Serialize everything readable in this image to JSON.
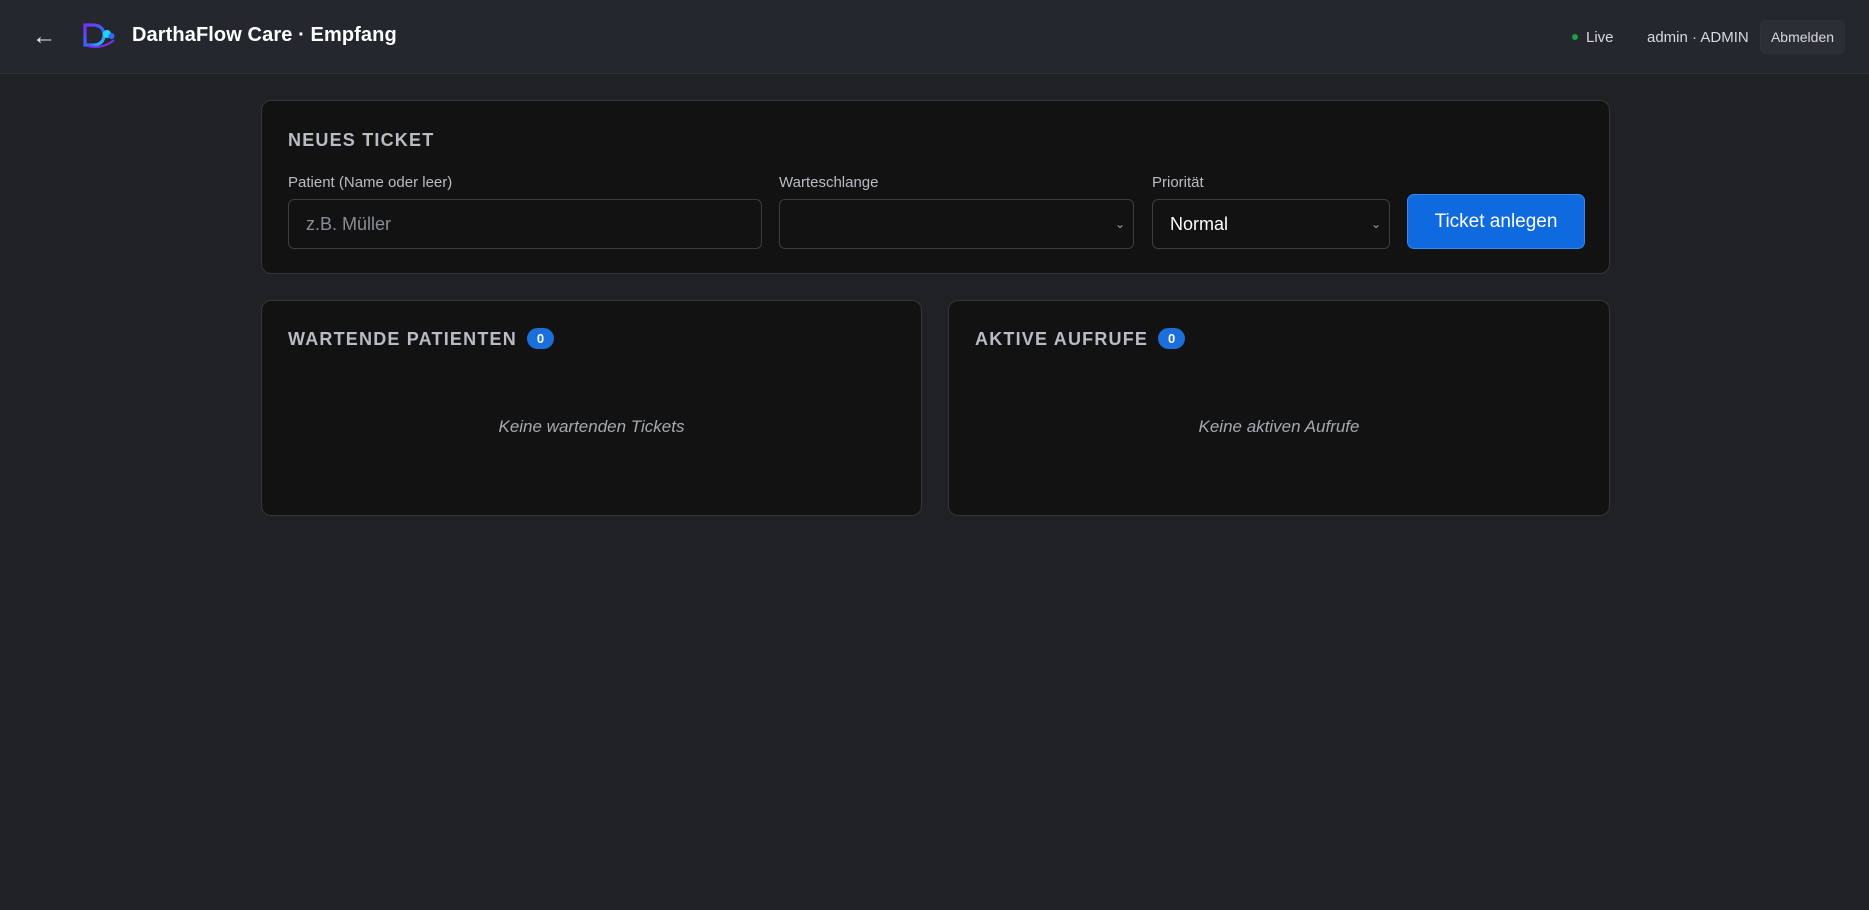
{
  "header": {
    "back_icon": "←",
    "title": "DarthaFlow Care · Empfang",
    "live_label": "Live",
    "user_label": "admin · ADMIN",
    "logout_label": "Abmelden"
  },
  "new_ticket": {
    "title": "NEUES TICKET",
    "patient_label": "Patient (Name oder leer)",
    "patient_placeholder": "z.B. Müller",
    "patient_value": "",
    "queue_label": "Warteschlange",
    "queue_value": "",
    "priority_label": "Priorität",
    "priority_value": "Normal",
    "submit_label": "Ticket anlegen"
  },
  "waiting": {
    "title": "WARTENDE PATIENTEN",
    "count": "0",
    "empty_text": "Keine wartenden Tickets"
  },
  "active": {
    "title": "AKTIVE AUFRUFE",
    "count": "0",
    "empty_text": "Keine aktiven Aufrufe"
  },
  "colors": {
    "accent": "#0f6ae0",
    "live": "#1e9e4a",
    "background": "#202124",
    "card": "#121213"
  }
}
